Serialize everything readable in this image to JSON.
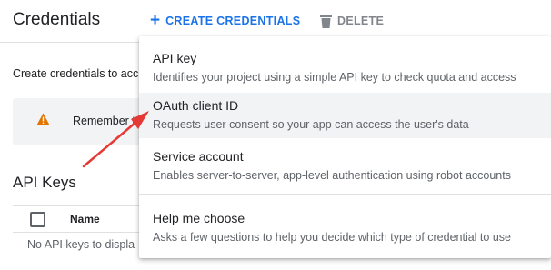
{
  "header": {
    "title": "Credentials",
    "create_label": "CREATE CREDENTIALS",
    "delete_label": "DELETE"
  },
  "intro_text": "Create credentials to acc",
  "warning": {
    "text": "Remember t"
  },
  "api_keys": {
    "title": "API Keys",
    "columns": [
      "Name"
    ],
    "empty_text": "No API keys to displa"
  },
  "menu": {
    "items": [
      {
        "title": "API key",
        "description": "Identifies your project using a simple API key to check quota and access"
      },
      {
        "title": "OAuth client ID",
        "description": "Requests user consent so your app can access the user's data"
      },
      {
        "title": "Service account",
        "description": "Enables server-to-server, app-level authentication using robot accounts"
      },
      {
        "title": "Help me choose",
        "description": "Asks a few questions to help you decide which type of credential to use"
      }
    ],
    "highlighted_item": "OAuth client ID"
  },
  "colors": {
    "accent": "#1a73e8",
    "warning": "#e37400",
    "annotation_arrow": "#e53935",
    "hover_background": "#f1f3f4"
  },
  "icons": [
    "plus-icon",
    "trash-icon",
    "warning-icon",
    "annotation-arrow"
  ]
}
